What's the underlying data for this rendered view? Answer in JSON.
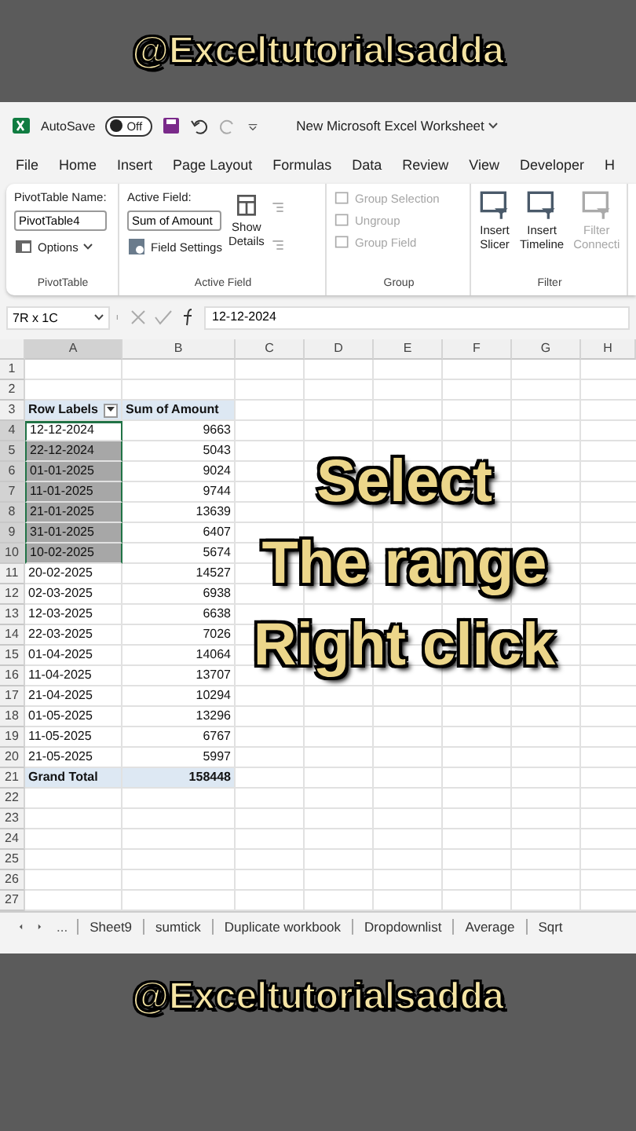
{
  "top_banner": {
    "handle": "@Exceltutorialsadda"
  },
  "title_bar": {
    "autosave_label": "AutoSave",
    "autosave_toggle": {
      "label": "Off",
      "on": false
    },
    "document_title": "New Microsoft Excel Worksheet"
  },
  "menu_tabs": [
    {
      "label": "File",
      "selected": false
    },
    {
      "label": "Home",
      "selected": false
    },
    {
      "label": "Insert",
      "selected": false
    },
    {
      "label": "Page Layout",
      "selected": false
    },
    {
      "label": "Formulas",
      "selected": false
    },
    {
      "label": "Data",
      "selected": false
    },
    {
      "label": "Review",
      "selected": false
    },
    {
      "label": "View",
      "selected": false
    },
    {
      "label": "Developer",
      "selected": false
    },
    {
      "label": "H",
      "selected": false
    }
  ],
  "ribbon": {
    "groups": [
      {
        "kind": "pivottable",
        "caption": "PivotTable",
        "name_label": "PivotTable Name:",
        "name_value": "PivotTable4",
        "options_button": "Options"
      },
      {
        "kind": "activefield",
        "caption": "Active Field",
        "field_label": "Active Field:",
        "field_value": "Sum of Amount",
        "settings_button": "Field Settings",
        "details_button": "Show Details"
      },
      {
        "kind": "group",
        "caption": "Group",
        "items": [
          {
            "label": "Group Selection",
            "disabled": true
          },
          {
            "label": "Ungroup",
            "disabled": true
          },
          {
            "label": "Group Field",
            "disabled": true
          }
        ]
      },
      {
        "kind": "filter",
        "caption": "Filter",
        "items": [
          {
            "label": "Insert Slicer",
            "disabled": false
          },
          {
            "label": "Insert Timeline",
            "disabled": false
          },
          {
            "label": "Filter Connecti",
            "disabled": true
          }
        ]
      }
    ]
  },
  "formula_bar": {
    "name_box": "7R x 1C",
    "formula": "12-12-2024"
  },
  "columns": [
    "A",
    "B",
    "C",
    "D",
    "E",
    "F",
    "G",
    "H"
  ],
  "rows": [
    {
      "number": "1",
      "kind": "empty",
      "selected": false,
      "active": false
    },
    {
      "number": "2",
      "kind": "empty",
      "selected": false,
      "active": false
    },
    {
      "number": "3",
      "kind": "header",
      "a": "Row Labels",
      "b": "Sum of Amount",
      "selected": false,
      "active": false
    },
    {
      "number": "4",
      "kind": "data",
      "a": "12-12-2024",
      "b": "9663",
      "selected": true,
      "active": true
    },
    {
      "number": "5",
      "kind": "data",
      "a": "22-12-2024",
      "b": "5043",
      "selected": true,
      "active": false
    },
    {
      "number": "6",
      "kind": "data",
      "a": "01-01-2025",
      "b": "9024",
      "selected": true,
      "active": false
    },
    {
      "number": "7",
      "kind": "data",
      "a": "11-01-2025",
      "b": "9744",
      "selected": true,
      "active": false
    },
    {
      "number": "8",
      "kind": "data",
      "a": "21-01-2025",
      "b": "13639",
      "selected": true,
      "active": false
    },
    {
      "number": "9",
      "kind": "data",
      "a": "31-01-2025",
      "b": "6407",
      "selected": true,
      "active": false
    },
    {
      "number": "10",
      "kind": "data",
      "a": "10-02-2025",
      "b": "5674",
      "selected": true,
      "active": false
    },
    {
      "number": "11",
      "kind": "data",
      "a": "20-02-2025",
      "b": "14527",
      "selected": false,
      "active": false
    },
    {
      "number": "12",
      "kind": "data",
      "a": "02-03-2025",
      "b": "6938",
      "selected": false,
      "active": false
    },
    {
      "number": "13",
      "kind": "data",
      "a": "12-03-2025",
      "b": "6638",
      "selected": false,
      "active": false
    },
    {
      "number": "14",
      "kind": "data",
      "a": "22-03-2025",
      "b": "7026",
      "selected": false,
      "active": false
    },
    {
      "number": "15",
      "kind": "data",
      "a": "01-04-2025",
      "b": "14064",
      "selected": false,
      "active": false
    },
    {
      "number": "16",
      "kind": "data",
      "a": "11-04-2025",
      "b": "13707",
      "selected": false,
      "active": false
    },
    {
      "number": "17",
      "kind": "data",
      "a": "21-04-2025",
      "b": "10294",
      "selected": false,
      "active": false
    },
    {
      "number": "18",
      "kind": "data",
      "a": "01-05-2025",
      "b": "13296",
      "selected": false,
      "active": false
    },
    {
      "number": "19",
      "kind": "data",
      "a": "11-05-2025",
      "b": "6767",
      "selected": false,
      "active": false
    },
    {
      "number": "20",
      "kind": "data",
      "a": "21-05-2025",
      "b": "5997",
      "selected": false,
      "active": false
    },
    {
      "number": "21",
      "kind": "total",
      "a": "Grand Total",
      "b": "158448",
      "selected": false,
      "active": false
    },
    {
      "number": "22",
      "kind": "empty",
      "selected": false,
      "active": false
    },
    {
      "number": "23",
      "kind": "empty",
      "selected": false,
      "active": false
    },
    {
      "number": "24",
      "kind": "empty",
      "selected": false,
      "active": false
    },
    {
      "number": "25",
      "kind": "empty",
      "selected": false,
      "active": false
    },
    {
      "number": "26",
      "kind": "empty",
      "selected": false,
      "active": false
    },
    {
      "number": "27",
      "kind": "empty",
      "selected": false,
      "active": false
    }
  ],
  "caption_overlay": [
    "Select",
    "The range",
    "Right click"
  ],
  "sheet_tabs": {
    "more": "...",
    "tabs": [
      {
        "label": "Sheet9",
        "selected": false
      },
      {
        "label": "sumtick",
        "selected": false
      },
      {
        "label": "Duplicate workbook",
        "selected": false
      },
      {
        "label": "Dropdownlist",
        "selected": false
      },
      {
        "label": "Average",
        "selected": false
      },
      {
        "label": "Sqrt",
        "selected": false
      }
    ]
  },
  "bottom_banner": {
    "handle": "@Exceltutorialsadda"
  }
}
